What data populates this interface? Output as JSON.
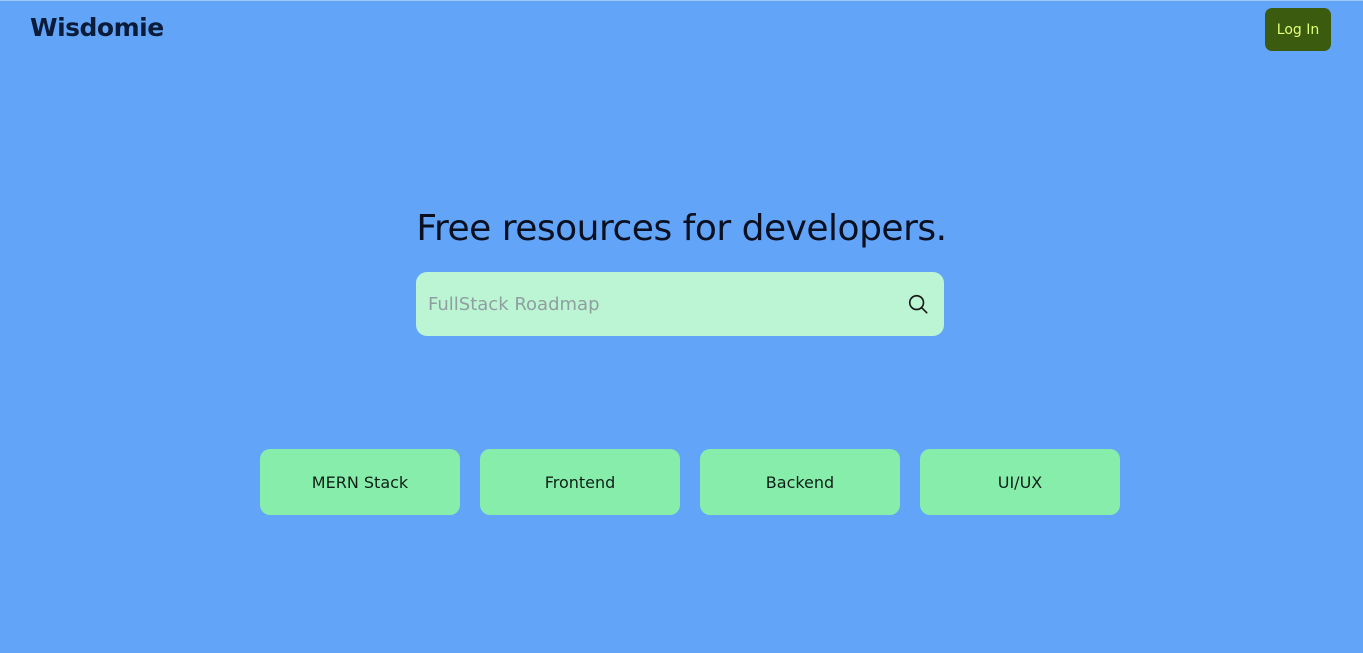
{
  "header": {
    "logo_text": "Wisdomie",
    "login_label": "Log In"
  },
  "hero": {
    "headline": "Free resources for developers.",
    "search": {
      "placeholder": "FullStack Roadmap",
      "value": "",
      "icon": "search-icon"
    }
  },
  "categories": [
    {
      "label": "MERN Stack"
    },
    {
      "label": "Frontend"
    },
    {
      "label": "Backend"
    },
    {
      "label": "UI/UX"
    }
  ],
  "colors": {
    "background": "#62a4f8",
    "login_bg": "#3b5b0f",
    "login_text": "#e3ff7a",
    "search_bg": "#bbf5d3",
    "category_bg": "#86eeaa"
  }
}
